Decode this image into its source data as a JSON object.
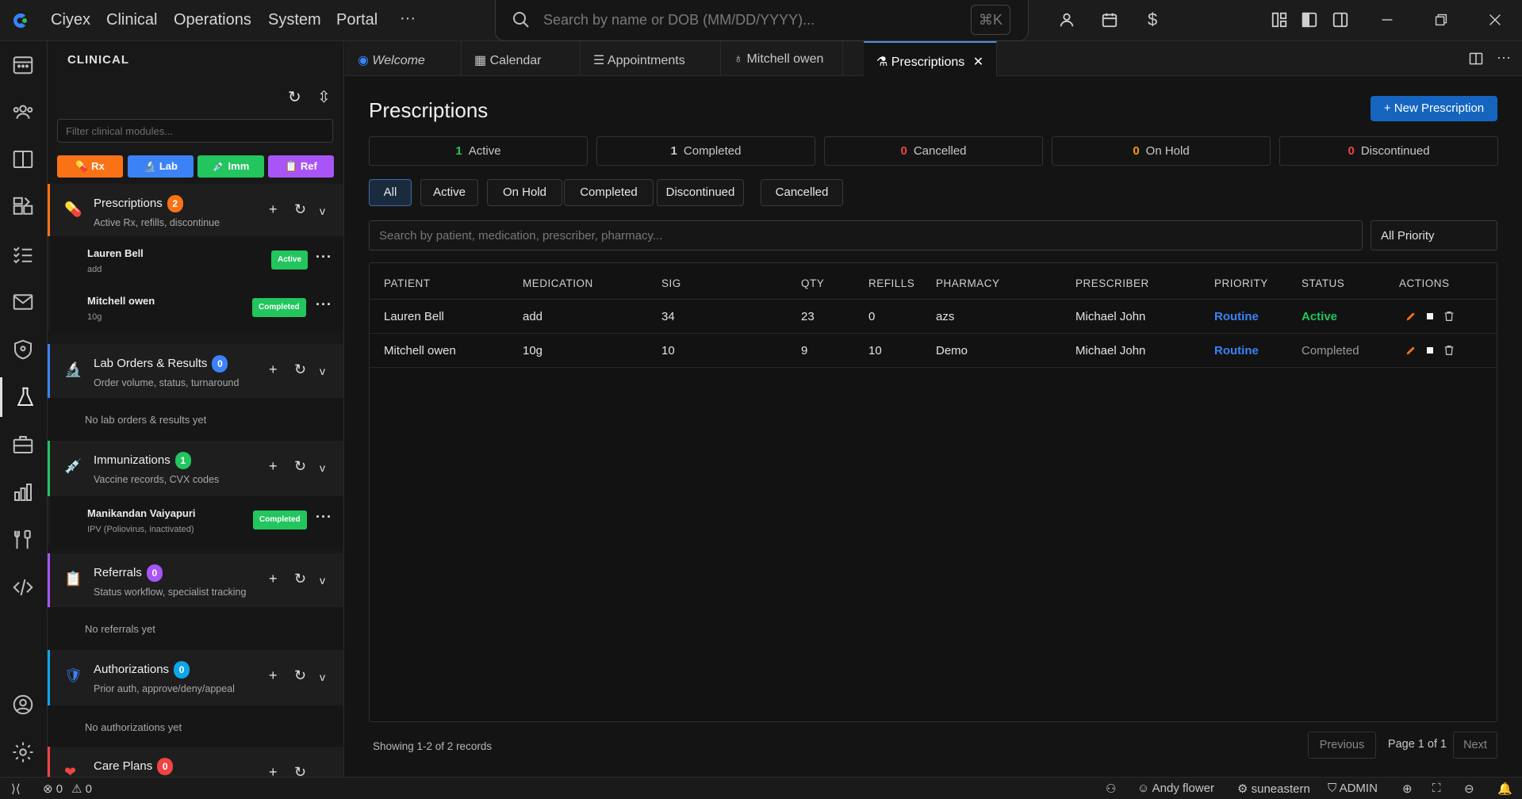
{
  "titlebar": {
    "brand": "Ciyex",
    "menu": [
      "Clinical",
      "Operations",
      "System",
      "Portal"
    ],
    "more": "···",
    "search_placeholder": "Search by name or DOB (MM/DD/YYYY)...",
    "shortcut": "⌘K",
    "dollar": "$"
  },
  "sidebar": {
    "header": "CLINICAL",
    "filter_placeholder": "Filter clinical modules...",
    "chips": [
      "Rx",
      "Lab",
      "Imm",
      "Ref"
    ],
    "modules": [
      {
        "title": "Prescriptions",
        "count": "2",
        "sub": "Active Rx, refills, discontinue",
        "color": "#f97316"
      },
      {
        "title": "Lab Orders & Results",
        "count": "0",
        "sub": "Order volume, status, turnaround",
        "color": "#3b82f6"
      },
      {
        "title": "Immunizations",
        "count": "1",
        "sub": "Vaccine records, CVX codes",
        "color": "#22c55e"
      },
      {
        "title": "Referrals",
        "count": "0",
        "sub": "Status workflow, specialist tracking",
        "color": "#a855f7"
      },
      {
        "title": "Authorizations",
        "count": "0",
        "sub": "Prior auth, approve/deny/appeal",
        "color": "#0ea5e9"
      },
      {
        "title": "Care Plans",
        "count": "0",
        "sub": "",
        "color": "#ef4444"
      }
    ],
    "rx_items": [
      {
        "name": "Lauren Bell",
        "detail": "add",
        "status": "Active"
      },
      {
        "name": "Mitchell owen",
        "detail": "10g",
        "status": "Completed"
      }
    ],
    "imm_items": [
      {
        "name": "Manikandan Vaiyapuri",
        "detail": "IPV (Poliovirus, inactivated)",
        "status": "Completed"
      }
    ],
    "empty": {
      "lab": "No lab orders & results yet",
      "ref": "No referrals yet",
      "auth": "No authorizations yet"
    }
  },
  "tabs": [
    "Welcome",
    "Calendar",
    "Appointments",
    "Mitchell owen",
    "Prescriptions"
  ],
  "main": {
    "title": "Prescriptions",
    "new_button": "+ New Prescription",
    "stats": [
      {
        "count": "1",
        "label": "Active",
        "color": "#22c55e"
      },
      {
        "count": "1",
        "label": "Completed",
        "color": "#c8c8c8"
      },
      {
        "count": "0",
        "label": "Cancelled",
        "color": "#ef4444"
      },
      {
        "count": "0",
        "label": "On Hold",
        "color": "#f59e0b"
      },
      {
        "count": "0",
        "label": "Discontinued",
        "color": "#ef4444"
      }
    ],
    "filters": [
      "All",
      "Active",
      "On Hold",
      "Completed",
      "Discontinued",
      "Cancelled"
    ],
    "search_placeholder": "Search by patient, medication, prescriber, pharmacy...",
    "priority_select": "All Priority",
    "columns": [
      "PATIENT",
      "MEDICATION",
      "SIG",
      "QTY",
      "REFILLS",
      "PHARMACY",
      "PRESCRIBER",
      "PRIORITY",
      "STATUS",
      "ACTIONS"
    ],
    "rows": [
      {
        "patient": "Lauren Bell",
        "medication": "add",
        "sig": "34",
        "qty": "23",
        "refills": "0",
        "pharmacy": "azs",
        "prescriber": "Michael John",
        "priority": "Routine",
        "status": "Active"
      },
      {
        "patient": "Mitchell owen",
        "medication": "10g",
        "sig": "10",
        "qty": "9",
        "refills": "10",
        "pharmacy": "Demo",
        "prescriber": "Michael John",
        "priority": "Routine",
        "status": "Completed"
      }
    ],
    "footer": "Showing 1-2 of 2 records",
    "pager": {
      "prev": "Previous",
      "page": "Page 1 of 1",
      "next": "Next"
    }
  },
  "statusbar": {
    "errors": "0",
    "warnings": "0",
    "user": "Andy flower",
    "org": "suneastern",
    "role": "ADMIN"
  }
}
